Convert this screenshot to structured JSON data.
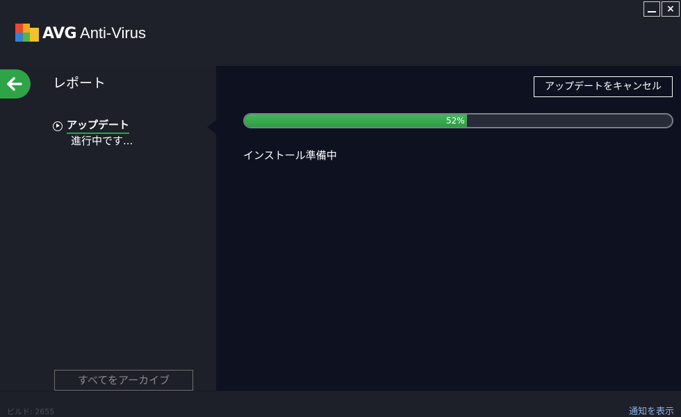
{
  "app": {
    "brand_bold": "AVG",
    "brand_rest": " Anti-Virus",
    "window_close_glyph": "×"
  },
  "nav": {
    "back_icon": "back-arrow-icon",
    "page_title": "レポート"
  },
  "reports": [
    {
      "name": "アップデート",
      "status": "進行中です..."
    }
  ],
  "left": {
    "archive_button": "すべてをアーカイブ"
  },
  "main": {
    "cancel_button": "アップデートをキャンセル",
    "progress_percent": 52,
    "progress_label": "52%",
    "status_text": "インストール準備中"
  },
  "footer": {
    "build": "ビルド: 2655",
    "notify_link": "通知を表示"
  },
  "colors": {
    "accent": "#2ea447",
    "background": "#1d2028",
    "panel": "#0e1220"
  }
}
